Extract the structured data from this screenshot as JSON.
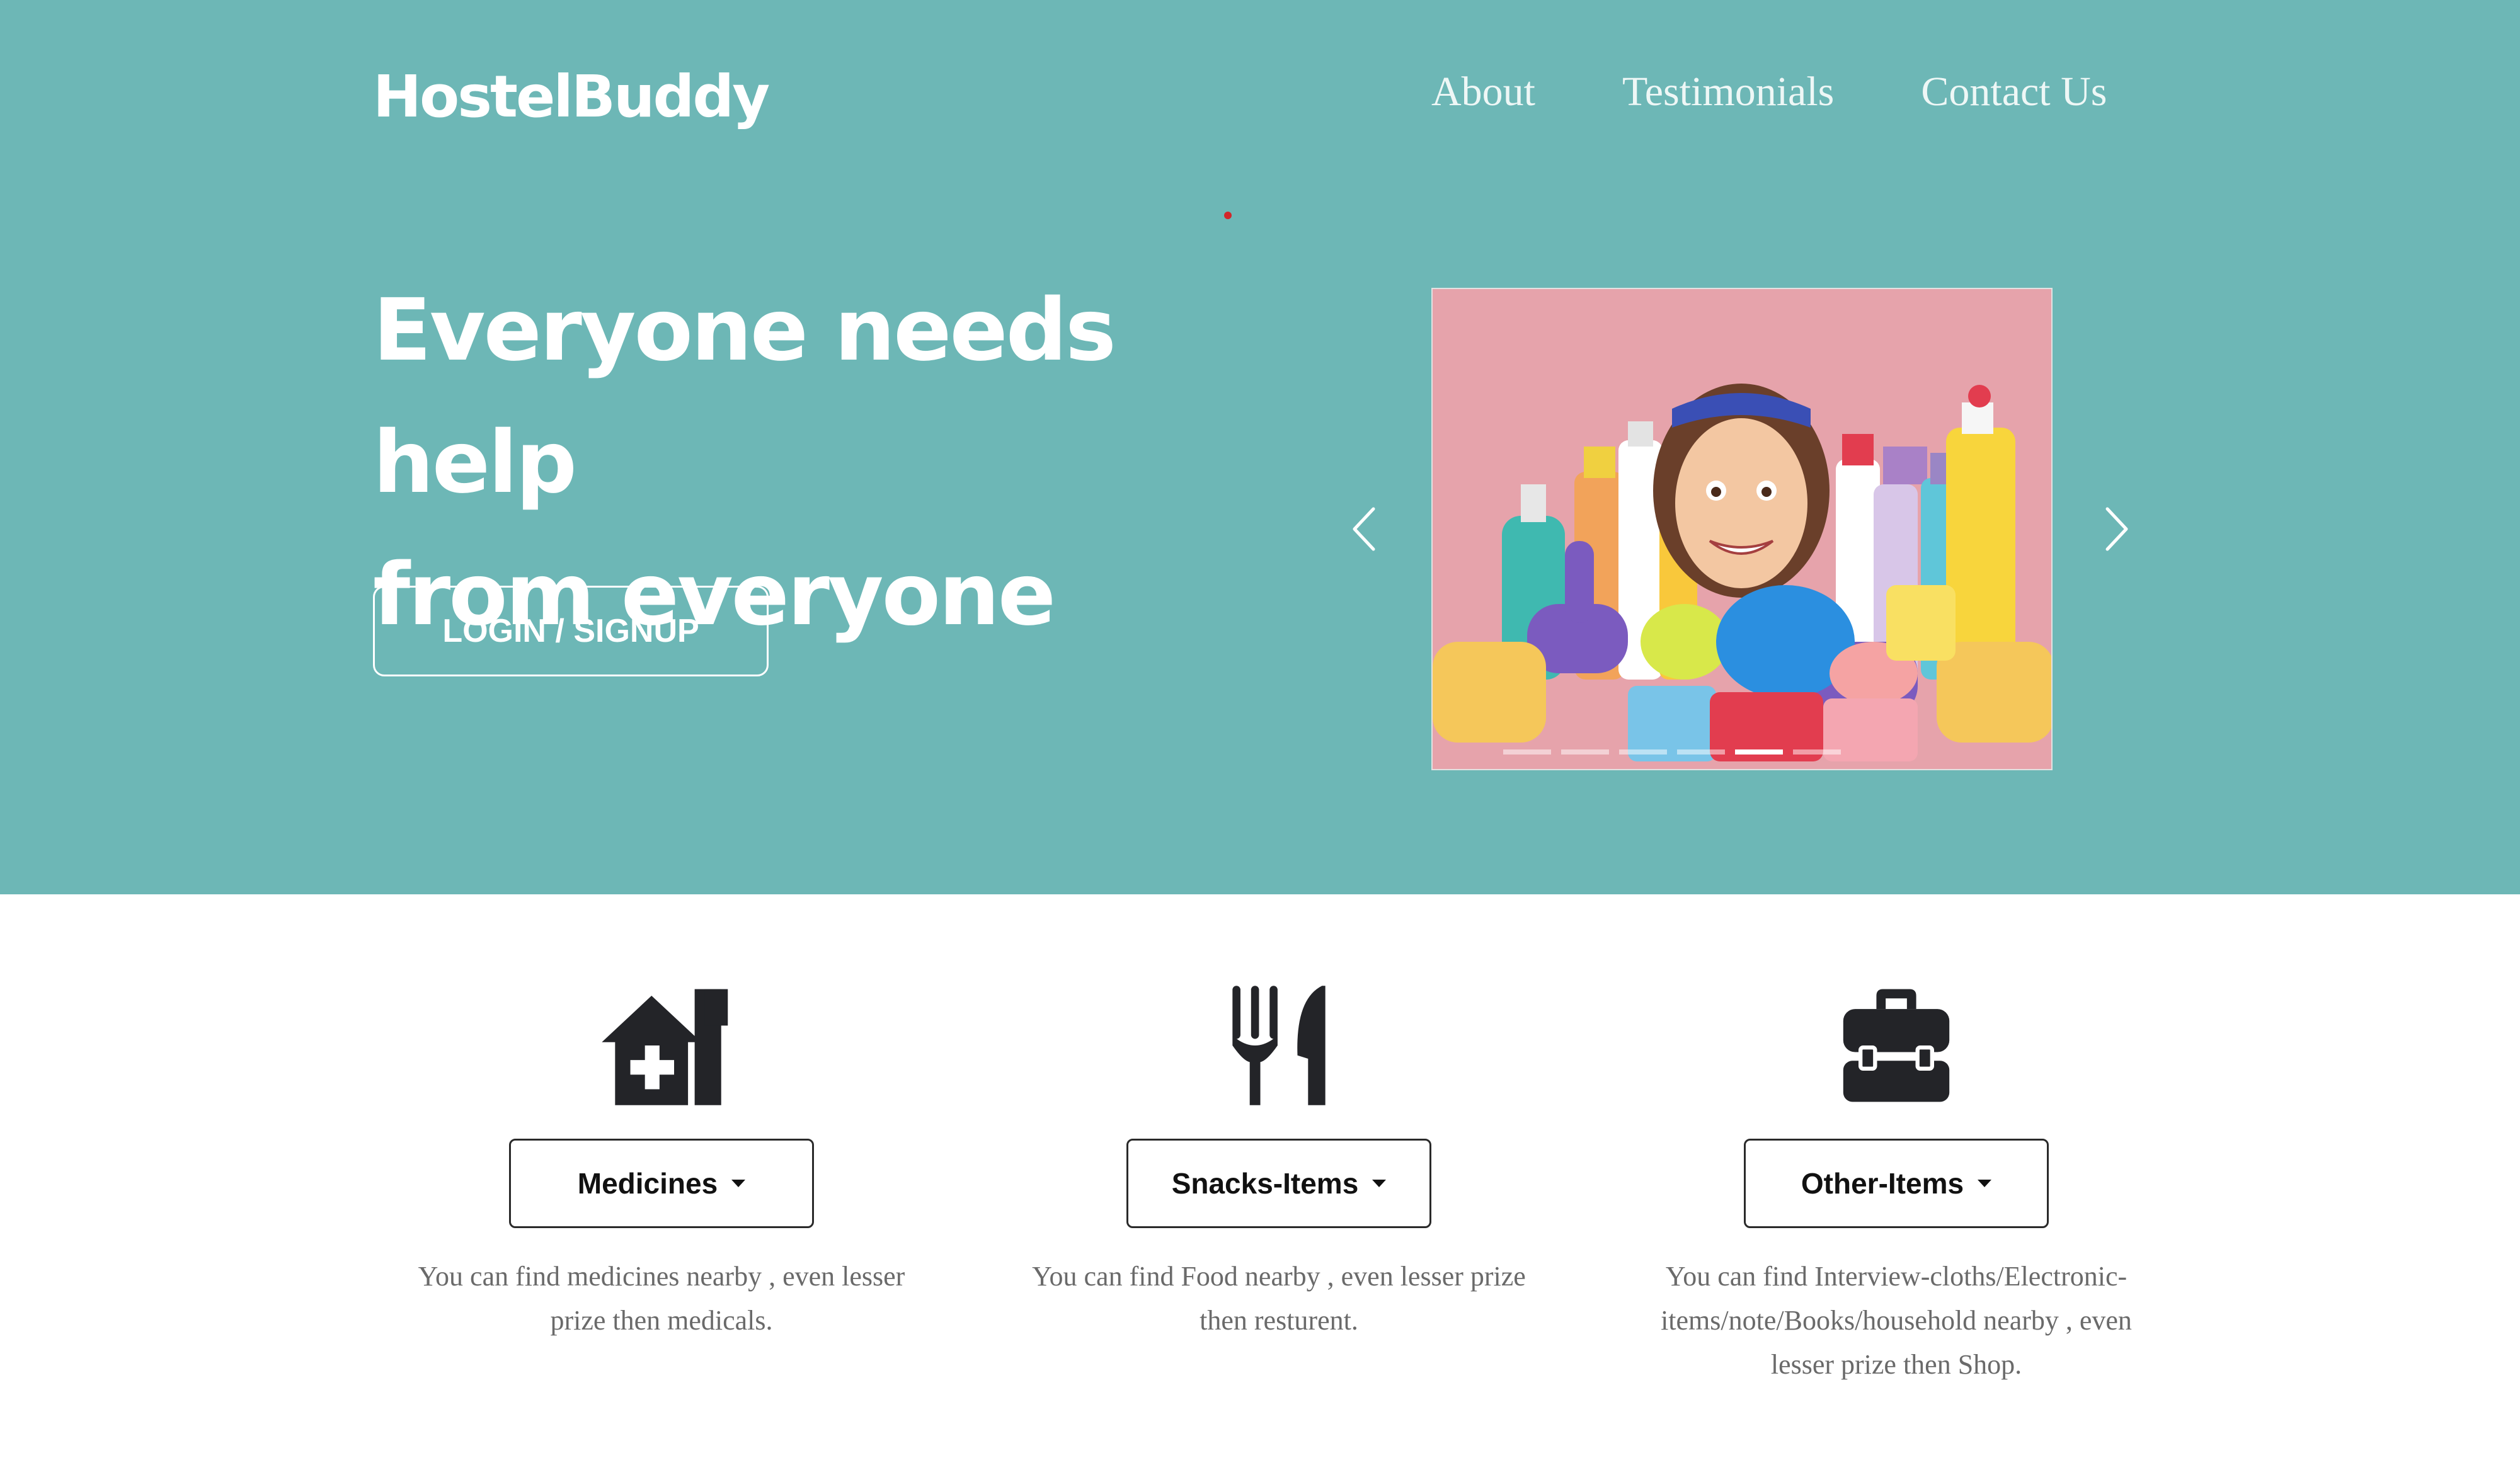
{
  "brand": "HostelBuddy",
  "nav": {
    "about": "About",
    "testimonials": "Testimonials",
    "contact": "Contact Us"
  },
  "hero": {
    "headline_line1": "Everyone needs help",
    "headline_line2": "from everyone",
    "login_label": "LOGIN / SIGNUP"
  },
  "carousel": {
    "image_icon": "cleaning-supplies-photo",
    "indicator_count": 6,
    "active_index": 5
  },
  "features": [
    {
      "icon": "house-medical-icon",
      "label": "Medicines",
      "description": "You can find medicines nearby , even lesser prize then medicals."
    },
    {
      "icon": "utensils-icon",
      "label": "Snacks-Items",
      "description": "You can find Food nearby , even lesser prize then resturent."
    },
    {
      "icon": "toolbox-icon",
      "label": "Other-Items",
      "description": "You can find Interview-cloths/Electronic-items/note/Books/household nearby , even lesser prize then Shop."
    }
  ],
  "colors": {
    "hero_bg": "#6db7b6",
    "photo_bg": "#e6a3ab",
    "text_dark": "#111111",
    "text_muted": "#6a6a6a"
  }
}
